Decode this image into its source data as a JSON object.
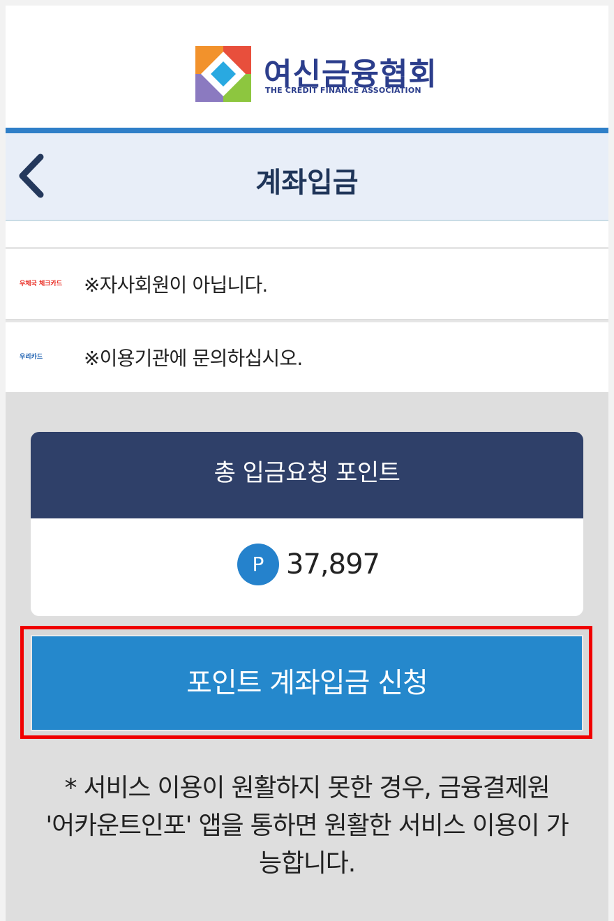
{
  "brand": {
    "name": "여신금융협회",
    "subtitle": "THE CREDIT FINANCE ASSOCIATION"
  },
  "header": {
    "title": "계좌입금",
    "back_icon": "chevron-left-icon"
  },
  "cards": [
    {
      "logo_text": "우체국 체크카드",
      "logo_color": "#e8261d",
      "message": "※자사회원이 아닙니다."
    },
    {
      "logo_text": "우리카드",
      "logo_color": "#1b5fb0",
      "message": "※이용기관에 문의하십시오."
    }
  ],
  "points": {
    "label": "총 입금요청 포인트",
    "badge": "P",
    "amount": "37,897"
  },
  "apply_button": "포인트 계좌입금 신청",
  "notice": {
    "line1": "* 서비스 이용이 원활하지 못한 경우, 금융결제원",
    "line2": "'어카운트인포' 앱을 통하면 원활한 서비스 이용이 가",
    "line3": "능합니다."
  },
  "colors": {
    "accent_blue": "#2588cc",
    "panel_navy": "#2f4069",
    "highlight": "#f00000"
  }
}
